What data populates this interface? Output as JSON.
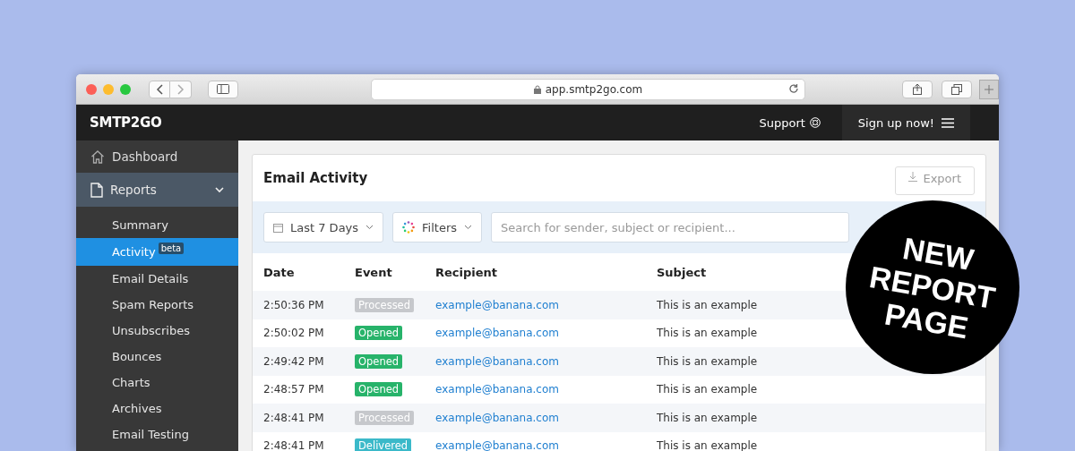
{
  "browser": {
    "url": "app.smtp2go.com"
  },
  "header": {
    "logo": "SMTP2GO",
    "support": "Support",
    "signup": "Sign up now!"
  },
  "sidebar": {
    "dashboard": {
      "label": "Dashboard"
    },
    "reports": {
      "label": "Reports",
      "expanded": true,
      "children": [
        {
          "label": "Summary",
          "selected": false
        },
        {
          "label": "Activity",
          "badge": "beta",
          "selected": true
        },
        {
          "label": "Email Details",
          "selected": false
        },
        {
          "label": "Spam Reports",
          "selected": false
        },
        {
          "label": "Unsubscribes",
          "selected": false
        },
        {
          "label": "Bounces",
          "selected": false
        },
        {
          "label": "Charts",
          "selected": false
        },
        {
          "label": "Archives",
          "selected": false
        },
        {
          "label": "Email Testing",
          "selected": false
        }
      ]
    }
  },
  "panel": {
    "title": "Email Activity",
    "export": "Export",
    "date_range": "Last 7 Days",
    "filters": "Filters",
    "search": {
      "placeholder": "Search for sender, subject or recipient..."
    }
  },
  "table": {
    "columns": [
      "Date",
      "Event",
      "Recipient",
      "Subject"
    ],
    "rows": [
      {
        "date": "2:50:36 PM",
        "event": "Processed",
        "kind": "processed",
        "recipient": "example@banana.com",
        "subject": "This is an example"
      },
      {
        "date": "2:50:02 PM",
        "event": "Opened",
        "kind": "opened",
        "recipient": "example@banana.com",
        "subject": "This is an example"
      },
      {
        "date": "2:49:42 PM",
        "event": "Opened",
        "kind": "opened",
        "recipient": "example@banana.com",
        "subject": "This is an example"
      },
      {
        "date": "2:48:57 PM",
        "event": "Opened",
        "kind": "opened",
        "recipient": "example@banana.com",
        "subject": "This is an example"
      },
      {
        "date": "2:48:41 PM",
        "event": "Processed",
        "kind": "processed",
        "recipient": "example@banana.com",
        "subject": "This is an example"
      },
      {
        "date": "2:48:41 PM",
        "event": "Delivered",
        "kind": "delivered",
        "recipient": "example@banana.com",
        "subject": "This is an example"
      }
    ]
  },
  "sticker": {
    "lines": [
      "NEW",
      "REPORT",
      "PAGE"
    ]
  }
}
